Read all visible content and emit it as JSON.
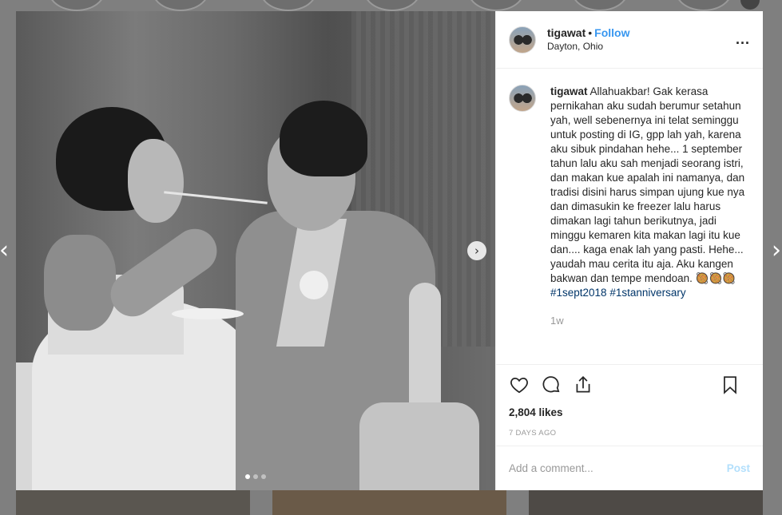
{
  "post": {
    "username": "tigawat",
    "separator": "•",
    "follow_label": "Follow",
    "location": "Dayton, Ohio",
    "more_label": "..."
  },
  "caption": {
    "username": "tigawat",
    "text": "Allahuakbar! Gak kerasa pernikahan aku sudah berumur setahun yah, well sebenernya ini telat seminggu untuk posting di IG, gpp lah yah, karena aku sibuk pindahan hehe... 1 september tahun lalu aku sah menjadi seorang istri, dan makan kue apalah ini namanya, dan tradisi disini harus simpan ujung kue nya dan dimasukin ke freezer lalu harus dimakan lagi tahun berikutnya, jadi minggu kemaren kita makan lagi itu kue dan.... kaga enak lah yang pasti. Hehe... yaudah mau cerita itu aja. Aku kangen bakwan dan tempe mendoan.",
    "emoji": "🥘🥘🥘",
    "hashtag1": "#1sept2018",
    "hashtag2": "#1stanniversary",
    "time_ago": "1w"
  },
  "stats": {
    "likes": "2,804 likes",
    "posted": "7 DAYS AGO"
  },
  "comment_box": {
    "placeholder": "Add a comment...",
    "post_label": "Post"
  },
  "carousel": {
    "next_arrow": "›",
    "slides": 3,
    "active": 1
  },
  "nav": {
    "prev_arrow": "‹",
    "next_arrow": "›"
  },
  "icons": [
    "heart-icon",
    "comment-icon",
    "share-icon",
    "bookmark-icon",
    "more-icon"
  ],
  "colors": {
    "follow": "#3897f0",
    "hashtag": "#003569",
    "post_disabled": "#b2dffc",
    "muted": "#999999"
  }
}
